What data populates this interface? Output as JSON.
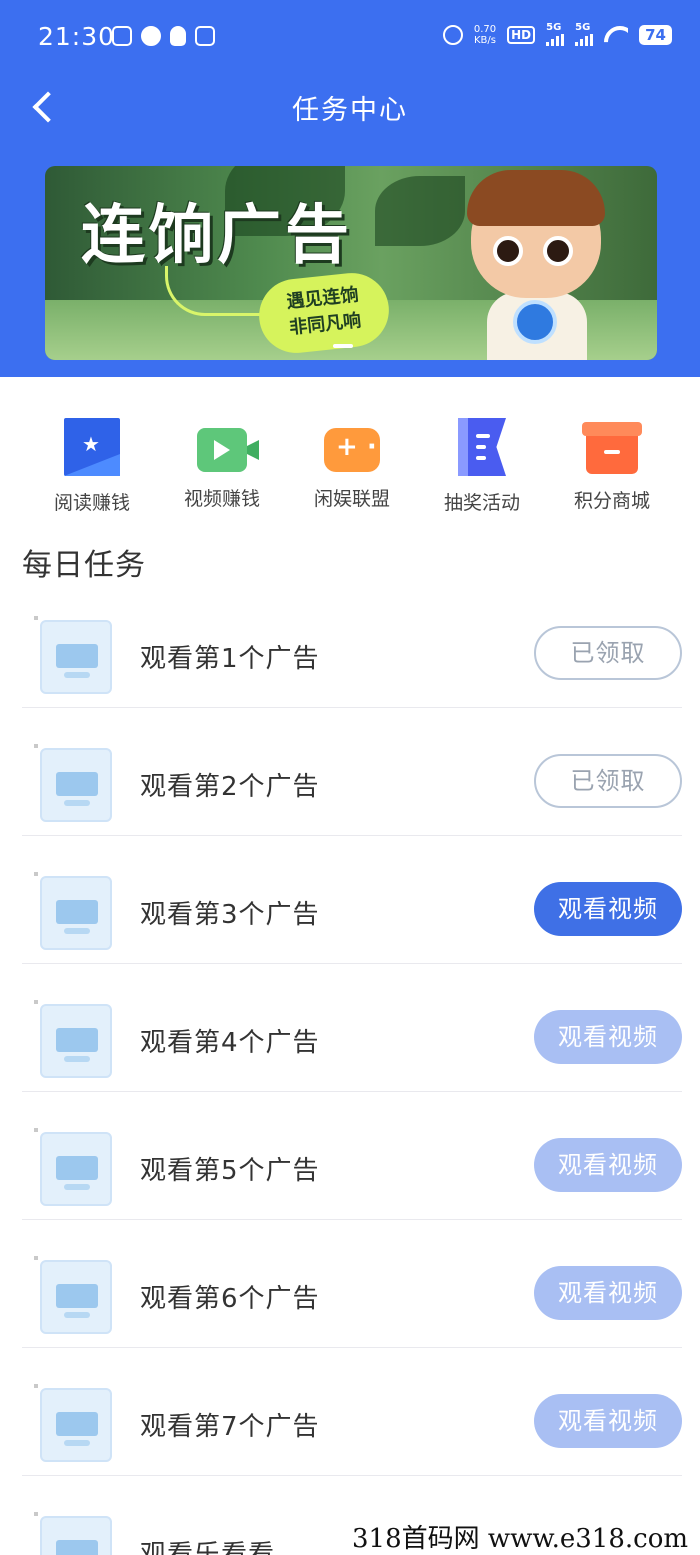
{
  "status_bar": {
    "time": "21:30",
    "net_speed_value": "0.70",
    "net_speed_unit": "KB/s",
    "hd_label": "HD",
    "signal_1": "5G",
    "signal_2": "5G",
    "battery": "74"
  },
  "nav": {
    "title": "任务中心"
  },
  "banner": {
    "title": "连饷广告",
    "slogan_line1": "遇见连饷",
    "slogan_line2": "非同凡响"
  },
  "shortcuts": [
    {
      "label": "阅读赚钱",
      "icon": "read-icon"
    },
    {
      "label": "视频赚钱",
      "icon": "video-icon"
    },
    {
      "label": "闲娱联盟",
      "icon": "game-icon"
    },
    {
      "label": "抽奖活动",
      "icon": "lottery-icon"
    },
    {
      "label": "积分商城",
      "icon": "shop-icon"
    }
  ],
  "section": {
    "title": "每日任务"
  },
  "tasks": [
    {
      "label": "观看第1个广告",
      "button": "已领取",
      "state": "claimed"
    },
    {
      "label": "观看第2个广告",
      "button": "已领取",
      "state": "claimed"
    },
    {
      "label": "观看第3个广告",
      "button": "观看视频",
      "state": "active"
    },
    {
      "label": "观看第4个广告",
      "button": "观看视频",
      "state": "disabled"
    },
    {
      "label": "观看第5个广告",
      "button": "观看视频",
      "state": "disabled"
    },
    {
      "label": "观看第6个广告",
      "button": "观看视频",
      "state": "disabled"
    },
    {
      "label": "观看第7个广告",
      "button": "观看视频",
      "state": "disabled"
    },
    {
      "label": "观看乐看看",
      "button": "",
      "state": "partial"
    }
  ],
  "watermark": "318首码网 www.e318.com",
  "colors": {
    "header_blue": "#3c6ff0",
    "button_active": "#3f70e6",
    "button_disabled": "#a9bff3"
  }
}
